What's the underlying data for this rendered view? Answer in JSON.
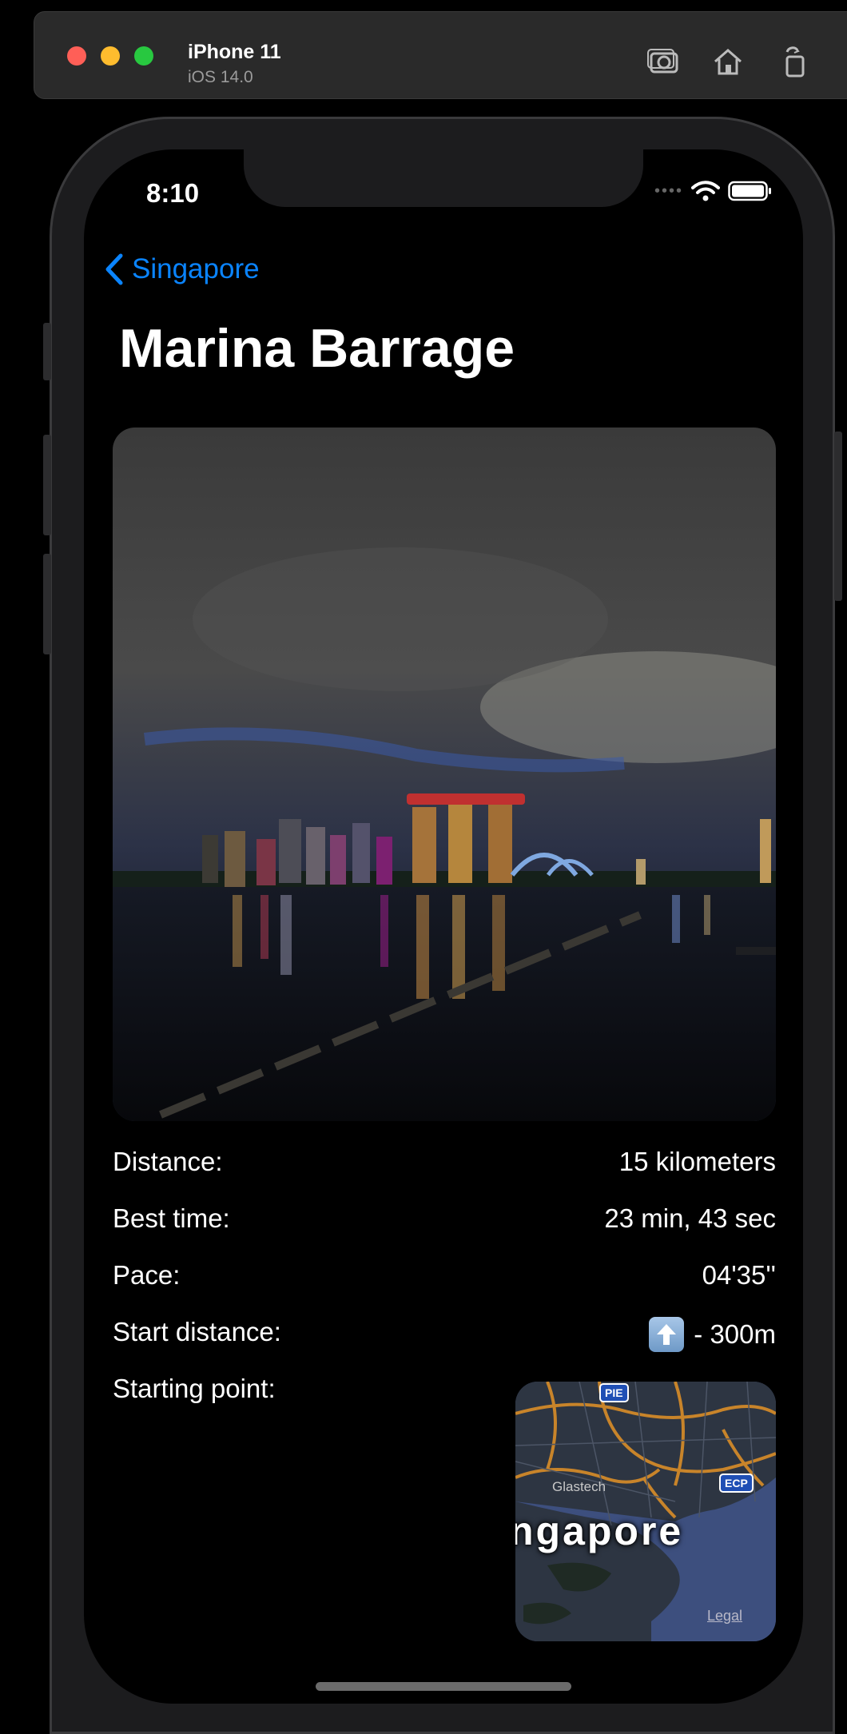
{
  "simulator": {
    "device_name": "iPhone 11",
    "os_version": "iOS 14.0",
    "icons": [
      "screenshot-icon",
      "home-icon",
      "rotate-icon"
    ]
  },
  "status_bar": {
    "time": "8:10",
    "icons": [
      "wifi-icon",
      "battery-icon"
    ]
  },
  "nav": {
    "back_label": "Singapore",
    "title": "Marina Barrage"
  },
  "details": {
    "rows": [
      {
        "label": "Distance:",
        "value": "15 kilometers"
      },
      {
        "label": "Best time:",
        "value": "23 min, 43 sec"
      },
      {
        "label": "Pace:",
        "value": "04'35''"
      },
      {
        "label": "Start distance:",
        "value": "- 300m",
        "icon": "up-arrow-icon"
      },
      {
        "label": "Starting point:",
        "value": ""
      }
    ]
  },
  "map": {
    "city_label": "ngapore",
    "place_label": "Glastech",
    "shields": [
      "PIE",
      "ECP"
    ],
    "legal_label": "Legal"
  },
  "colors": {
    "accent": "#0a84ff",
    "background": "#000000"
  }
}
